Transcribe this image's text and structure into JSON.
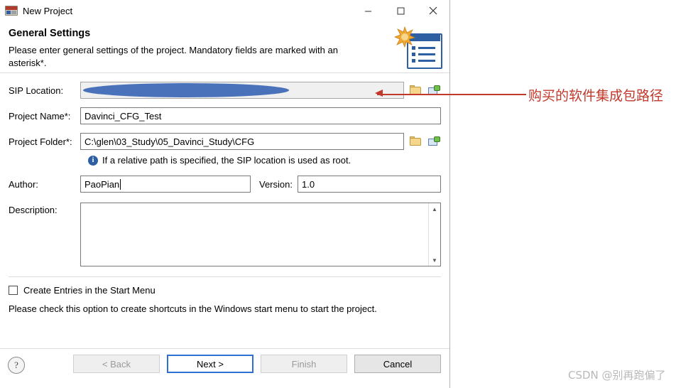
{
  "window": {
    "title": "New Project",
    "icon": "cfg-app-icon",
    "minimize": "minimize-icon",
    "maximize": "maximize-icon",
    "close": "close-icon"
  },
  "header": {
    "heading": "General Settings",
    "description": "Please enter general settings of the project. Mandatory fields are marked with an asterisk*.",
    "graphic": "wizard-banner-icon"
  },
  "form": {
    "sip_location": {
      "label": "SIP Location:",
      "value": "",
      "redacted": true,
      "browse_icon": "folder-browse-icon",
      "variable_icon": "variable-insert-icon"
    },
    "project_name": {
      "label": "Project Name*:",
      "value": "Davinci_CFG_Test"
    },
    "project_folder": {
      "label": "Project Folder*:",
      "value": "C:\\glen\\03_Study\\05_Davinci_Study\\CFG",
      "browse_icon": "folder-browse-icon",
      "variable_icon": "variable-insert-icon"
    },
    "hint": {
      "icon": "info-icon",
      "text": "If a relative path is specified, the SIP location is used as root."
    },
    "author": {
      "label": "Author:",
      "value": "PaoPian"
    },
    "version": {
      "label": "Version:",
      "value": "1.0"
    },
    "description": {
      "label": "Description:",
      "value": ""
    },
    "start_menu": {
      "label": "Create Entries in the Start Menu",
      "checked": false
    },
    "note": "Please check this option to create shortcuts in the Windows start menu to start the project."
  },
  "footer": {
    "help": "?",
    "back": "< Back",
    "next": "Next >",
    "finish": "Finish",
    "cancel": "Cancel"
  },
  "annotation": {
    "text": "购买的软件集成包路径",
    "color": "#c0392b"
  },
  "watermark": "CSDN @别再跑偏了"
}
